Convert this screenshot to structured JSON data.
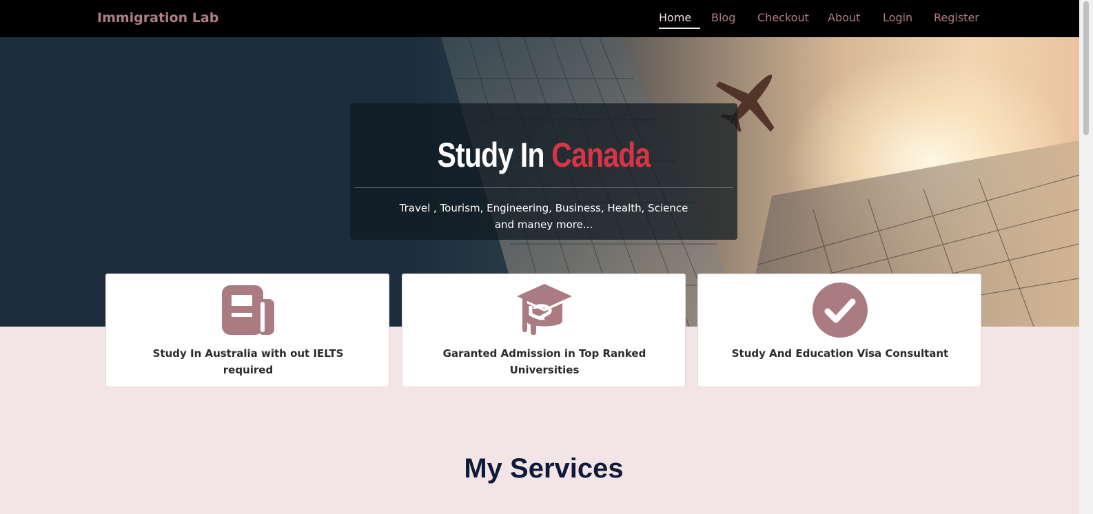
{
  "navbar": {
    "brand": "Immigration Lab",
    "links": [
      {
        "label": "Home",
        "active": true
      },
      {
        "label": "Blog"
      },
      {
        "label": "Checkout"
      },
      {
        "label": "About"
      },
      {
        "label": "Login"
      },
      {
        "label": "Register"
      }
    ]
  },
  "hero": {
    "title_part1": "Study In",
    "title_part2": "Canada",
    "subtitle": "Travel , Tourism, Engineering, Business, Health, Science and maney more..."
  },
  "cards": [
    {
      "icon": "newspaper-icon",
      "text": "Study In Australia with out IELTS required"
    },
    {
      "icon": "graduation-cap-icon",
      "text": "Garanted Admission in Top Ranked Universities"
    },
    {
      "icon": "check-circle-icon",
      "text": "Study And Education Visa Consultant"
    }
  ],
  "services": {
    "title": "My Services"
  },
  "colors": {
    "accent": "#b07d84",
    "highlight_red": "#d83447",
    "page_bg": "#f3e4e6",
    "navbar_bg": "#000000",
    "heading": "#0e1a3a"
  }
}
